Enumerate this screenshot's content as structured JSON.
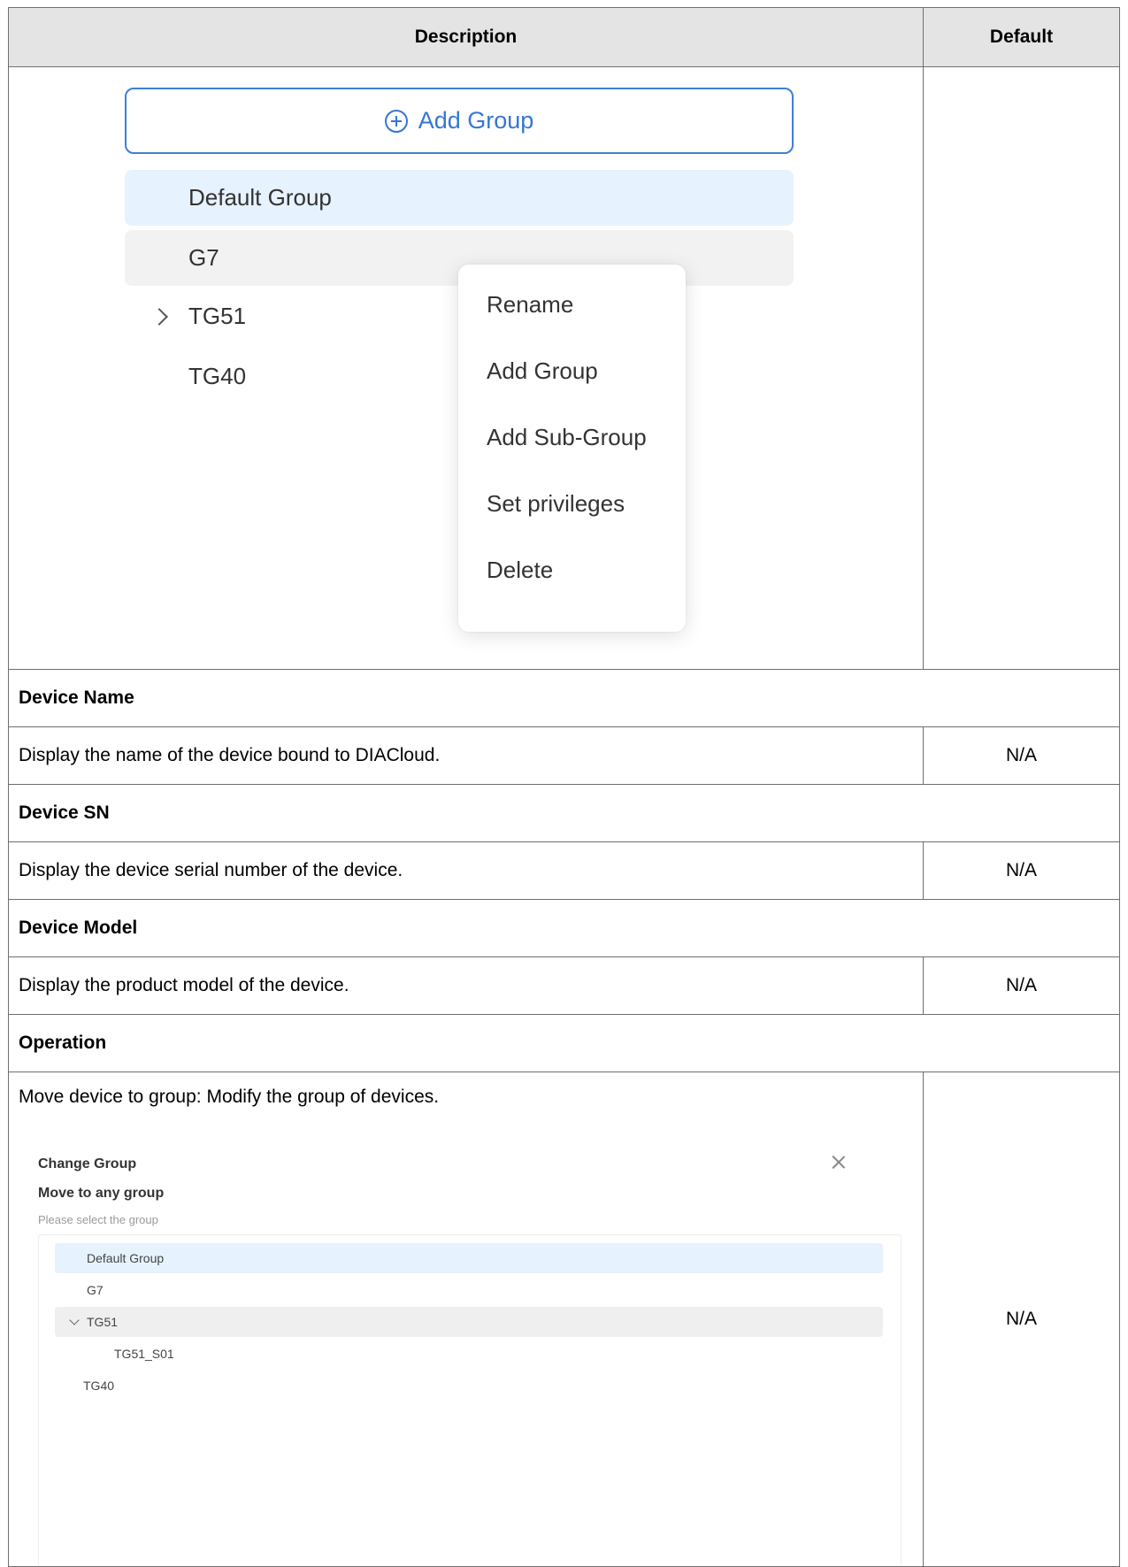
{
  "table": {
    "header": {
      "description": "Description",
      "default": "Default"
    },
    "group_screenshot": {
      "add_group_label": "Add Group",
      "tree": [
        "Default Group",
        "G7",
        "TG51",
        "TG40"
      ],
      "context_menu": [
        "Rename",
        "Add Group",
        "Add Sub-Group",
        "Set privileges",
        "Delete"
      ]
    },
    "rows": [
      {
        "title": "Device Name",
        "description": "Display the name of the device bound to DIACloud.",
        "default": "N/A"
      },
      {
        "title": "Device SN",
        "description": "Display the device serial number of the device.",
        "default": "N/A"
      },
      {
        "title": "Device Model",
        "description": "Display the product model of the device.",
        "default": "N/A"
      }
    ],
    "operation": {
      "title": "Operation",
      "description": "Move device to group: Modify the group of devices.",
      "default": "N/A",
      "dialog": {
        "title": "Change Group",
        "subtitle": "Move to any group",
        "hint": "Please select the group",
        "tree": [
          "Default Group",
          "G7",
          "TG51",
          "TG51_S01",
          "TG40"
        ]
      }
    }
  }
}
